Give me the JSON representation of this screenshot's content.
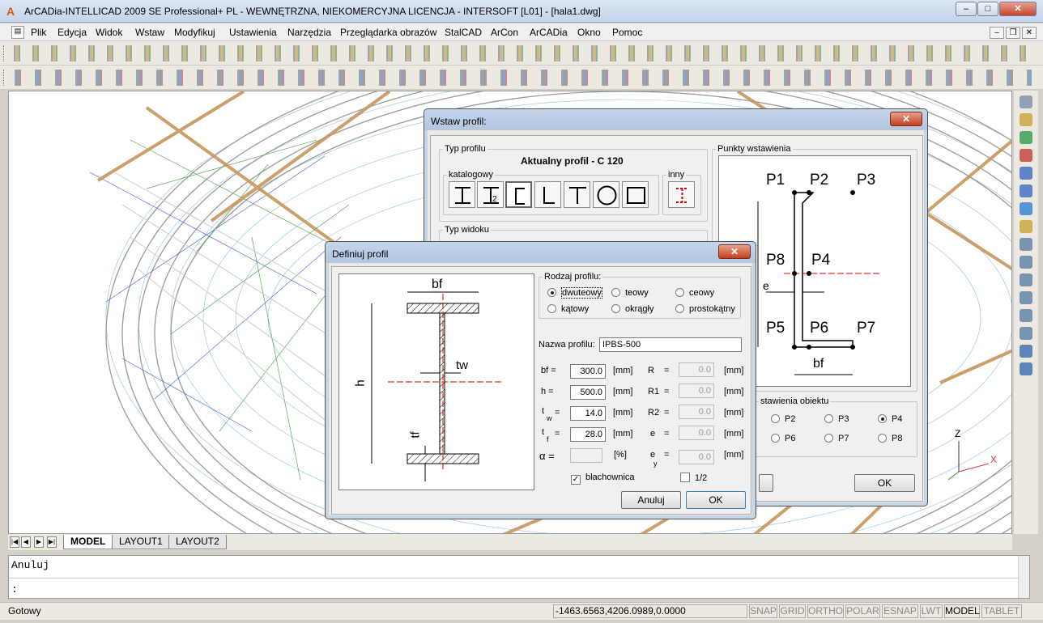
{
  "app": {
    "title": "ArCADia-INTELLICAD 2009 SE Professional+ PL - WEWNĘTRZNA, NIEKOMERCYJNA LICENCJA - INTERSOFT [L01] - [hala1.dwg]"
  },
  "menu": [
    "Plik",
    "Edycja",
    "Widok",
    "Wstaw",
    "Modyfikuj",
    "Ustawienia",
    "Narzędzia",
    "Przeglądarka obrazów",
    "StalCAD",
    "ArCon",
    "ArCADia",
    "Okno",
    "Pomoc"
  ],
  "layout_tabs": {
    "model": "MODEL",
    "layout1": "LAYOUT1",
    "layout2": "LAYOUT2"
  },
  "command": {
    "line1": "Anuluj",
    "prompt": ":"
  },
  "status": {
    "text": "Gotowy",
    "coords": "-1463.6563,4206.0989,0.0000",
    "toggles": [
      "SNAP",
      "GRID",
      "ORTHO",
      "POLAR",
      "ESNAP",
      "LWT",
      "MODEL",
      "TABLET"
    ]
  },
  "wstaw": {
    "title": "Wstaw profil:",
    "typ_profilu": "Typ profilu",
    "aktualny": "Aktualny profil - C 120",
    "katalogowy": "katalogowy",
    "inny": "inny",
    "typ_widoku": "Typ widoku",
    "punkty": "Punkty wstawienia",
    "punkty_obiektu": "stawienia obiektu",
    "points": {
      "p1": "P1",
      "p2": "P2",
      "p3": "P3",
      "p4": "P4",
      "p5": "P5",
      "p6": "P6",
      "p7": "P7",
      "p8": "P8"
    },
    "dim_e": "e",
    "dim_bf": "bf",
    "radio_opts": [
      "P2",
      "P3",
      "P4",
      "P6",
      "P7",
      "P8"
    ],
    "selected": "P4",
    "ok": "OK"
  },
  "definiuj": {
    "title": "Definiuj profil",
    "rodzaj": "Rodzaj profilu:",
    "types": [
      "dwuteowy",
      "teowy",
      "ceowy",
      "kątowy",
      "okrągły",
      "prostokątny"
    ],
    "selected_type": "dwuteowy",
    "nazwa_label": "Nazwa profilu:",
    "nazwa": "IPBS-500",
    "params": [
      {
        "label": "bf =",
        "value": "300.0",
        "unit": "[mm]"
      },
      {
        "label": "h =",
        "value": "500.0",
        "unit": "[mm]"
      },
      {
        "label": "t",
        "sub": "w",
        "eq": "=",
        "value": "14.0",
        "unit": "[mm]"
      },
      {
        "label": "t",
        "sub": "f",
        "eq": "=",
        "value": "28.0",
        "unit": "[mm]"
      },
      {
        "label": "α =",
        "value": "",
        "unit": "[%]"
      }
    ],
    "params2": [
      {
        "label": "R",
        "eq": "=",
        "value": "0.0",
        "unit": "[mm]"
      },
      {
        "label": "R1",
        "eq": "=",
        "value": "0.0",
        "unit": "[mm]"
      },
      {
        "label": "R2",
        "eq": "=",
        "value": "0.0",
        "unit": "[mm]"
      },
      {
        "label": "e",
        "eq": "=",
        "value": "0.0",
        "unit": "[mm]"
      },
      {
        "label": "e",
        "sub": "y",
        "eq": "=",
        "value": "0.0",
        "unit": "[mm]"
      }
    ],
    "blachownica": "blachownica",
    "half": "1/2",
    "diagram": {
      "bf": "bf",
      "tw": "tw",
      "tf": "tf",
      "h": "h"
    },
    "cancel": "Anuluj",
    "ok": "OK"
  },
  "axis": {
    "z": "Z",
    "x": "X"
  }
}
